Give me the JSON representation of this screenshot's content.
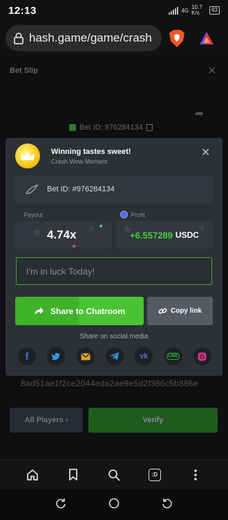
{
  "status_bar": {
    "time": "12:13",
    "network": "4G",
    "speed": "10.7 K/s",
    "battery": "63"
  },
  "browser": {
    "url": "hash.game/game/crash",
    "tabs_count": ":D"
  },
  "background": {
    "title": "Bet Slip",
    "bet_id": "Bet ID: 976284134",
    "hash": "8ad51ae1f2ce2044eda2ae9e5d2f366c5b886e",
    "all_players_label": "All Players ›",
    "verify_label": "Verify"
  },
  "modal": {
    "title": "Winning tastes sweet!",
    "subtitle": "Crash Wow Moment",
    "bet_id": "Bet ID: #976284134",
    "payout_label": "Payout",
    "payout_value": "4.74x",
    "profit_label": "Profit",
    "profit_value": "+6.557289",
    "profit_currency": "USDC",
    "message_placeholder": "I'm in luck Today!",
    "share_label": "Share to Chatroom",
    "copy_label": "Copy link",
    "social_label": "Share on social media",
    "social": [
      {
        "name": "facebook",
        "glyph": "f",
        "color": "#3b6fd8"
      },
      {
        "name": "twitter",
        "glyph": "t",
        "color": "#2d9be6"
      },
      {
        "name": "email",
        "glyph": "✉",
        "color": "#d6a52a"
      },
      {
        "name": "telegram",
        "glyph": "➤",
        "color": "#2f8fc8"
      },
      {
        "name": "vk",
        "glyph": "vk",
        "color": "#4a78c0"
      },
      {
        "name": "line",
        "glyph": "LINE",
        "color": "#2fb83a"
      },
      {
        "name": "instagram",
        "glyph": "◎",
        "color": "#d8348a"
      }
    ]
  }
}
